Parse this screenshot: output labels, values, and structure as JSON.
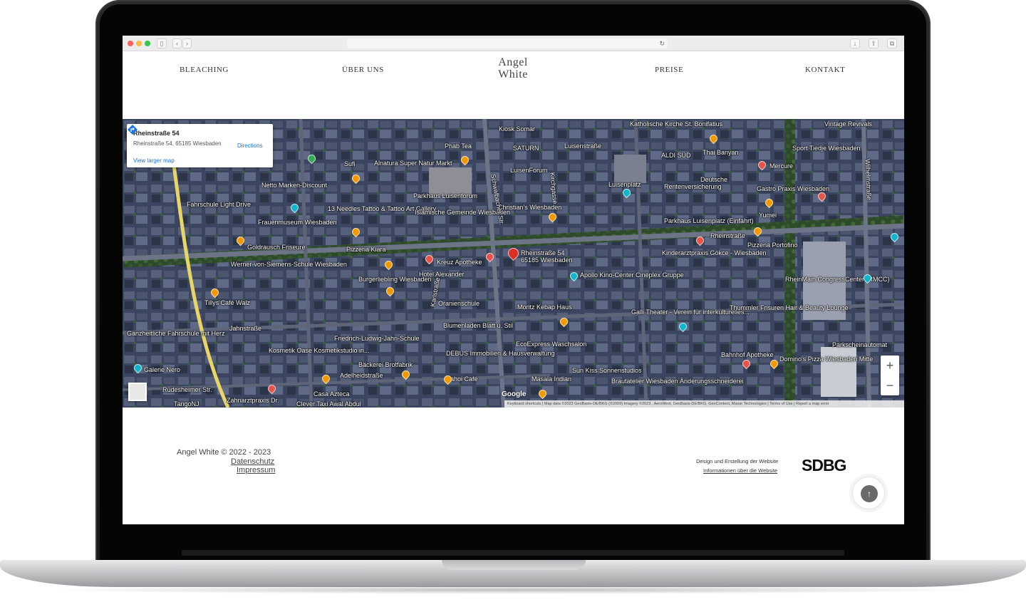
{
  "nav": {
    "items": [
      "BLEACHING",
      "ÜBER UNS",
      "PREISE",
      "KONTAKT"
    ],
    "logo_line1": "Angel",
    "logo_line2": "White"
  },
  "map": {
    "info_card": {
      "title": "Rheinstraße 54",
      "address": "Rheinstraße 54, 65185 Wiesbaden",
      "directions_label": "Directions",
      "larger_map_link": "View larger map"
    },
    "selected_pin_label": "Rheinstraße 54\n65185 Wiesbaden",
    "labels": [
      "Katholische Kirche St. Bonifatius",
      "Vintage Revivals",
      "Kiosk Somar",
      "Phab Tea",
      "SATURN",
      "LuisenForum",
      "Alnatura Super Natur Markt",
      "Sufi",
      "Netto Marken-Discount",
      "Fahrschule Light Drive",
      "13 Needles Tattoo & Tattoo Art Gallery",
      "Frauenmuseum Wiesbaden",
      "Parkhaus Luisenforum",
      "Islamische Gemeinde Wiesbaden",
      "Christian's Wiesbaden",
      "Luisenplatz",
      "ALDI SÜD",
      "Thai Banyan",
      "Sport Tiedje Wiesbaden",
      "Mercure",
      "Rentenversicherung",
      "Deutsche",
      "Gastro Praxis Wiesbaden",
      "Yumei",
      "Parkhaus Luisenplatz (Einfahrt)",
      "Rheinstraße",
      "Pizzeria Portofino",
      "Goldrausch Friseure",
      "Pizzeria Kiara",
      "Kreuz Apotheke",
      "Hotel Alexander",
      "Werner-von-Siemens-Schule Wiesbaden",
      "Burgerliebling Wiesbaden",
      "Apollo Kino-Center Cineplex Gruppe",
      "Kinderarztpraxis Gökce - Wiesbaden",
      "RheinMain CongressCenter (RMCC)",
      "Tillys Café Walz",
      "Oranienschule",
      "Moritz Kebap Haus",
      "Galli Theater - Verein für interkulturelles...",
      "Thummler Frisuren Hair & Beauty Lounge",
      "Blumenladen Blatt u. Stil",
      "Friedrich-Ludwig-Jahn-Schule",
      "EcoExpress Waschsalon",
      "Ganzheitliche Fahrschule mit Herz",
      "Kosmetik Oase Kosmetikstudio in...",
      "DEBUS Immobilien & Hausverwaltung",
      "Bahnhof Apotheke",
      "Domino's Pizza Wiesbaden Mitte",
      "Parkscheinautomat",
      "Galerie Nero",
      "Bäckerei Brotfabrik",
      "Sun Kiss Sonnenstudios",
      "ahoi Café",
      "Masala Indian",
      "Brautatelier Wiesbaden Änderungsschneiderei",
      "Casa Azteca",
      "Zahnarztpraxis Dr.",
      "Clever Taxi Awal Abdul",
      "TangoNJ",
      "Adelheidstraße",
      "Jahnstraße",
      "Karlstraße",
      "Schwalbacher Str.",
      "Rüdesheimer Str.",
      "Luisenstraße",
      "Kirchgasse",
      "Wilhelmstraße"
    ],
    "zoom_in": "+",
    "zoom_out": "−",
    "google_logo": "Google",
    "attribution": "Keyboard shortcuts  |  Map data ©2023 GeoBasis-DE/BKG (©2009) Imagery ©2023 , AeroWest, GeoBasis-DE/BKG, GeoContent, Maxar Technologies  |  Terms of Use  |  Report a map error"
  },
  "footer": {
    "copyright": "Angel White © 2022 - 2023",
    "datenschutz": "Datenschutz",
    "impressum": "Impressum",
    "design_text": "Design und Erstellung der Website",
    "design_link": "Informationen über die Website",
    "brand": "SDBG"
  },
  "colors": {
    "map_base": "#3a4359",
    "link_blue": "#1a73e8",
    "pin_orange": "#f29900",
    "pin_red": "#e5534b",
    "pin_teal": "#12b5cb",
    "pin_blue": "#4b86e6",
    "selected_pin": "#d93025"
  }
}
